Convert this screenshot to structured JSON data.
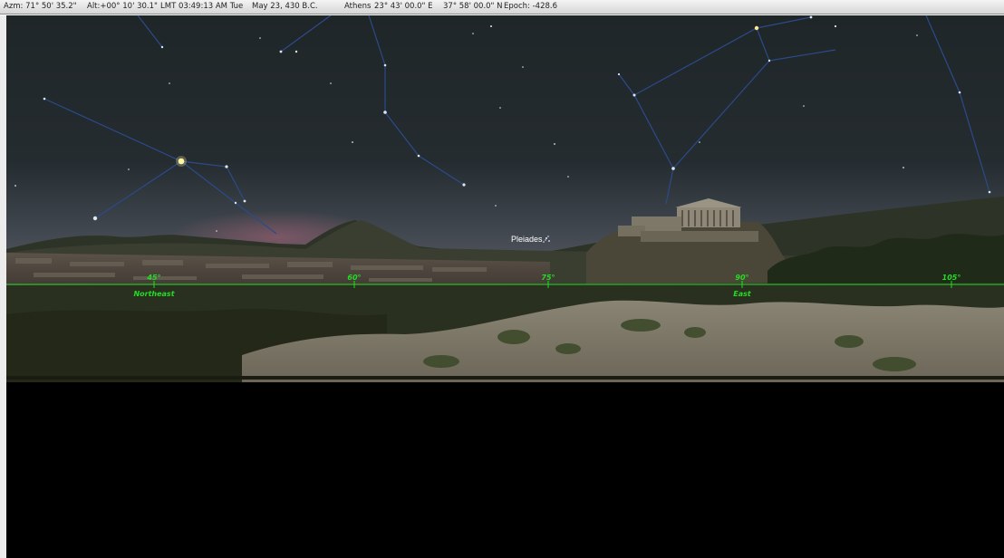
{
  "statusbar": {
    "azm": "Azm: 71° 50' 35.2\"",
    "alt": "Alt:+00° 10' 30.1\"",
    "lmt": "LMT 03:49:13 AM  Tue",
    "date": "May 23, 430 B.C.",
    "location": "Athens",
    "longitude": "23° 43' 00.0\" E",
    "latitude": "37° 58' 00.0\" N",
    "epoch": "Epoch: -428.6"
  },
  "sky": {
    "object_label": "Pleiades"
  },
  "horizon": {
    "color": "#22dd22",
    "ticks": [
      {
        "degree": "45°",
        "direction": "Northeast"
      },
      {
        "degree": "60°",
        "direction": ""
      },
      {
        "degree": "75°",
        "direction": ""
      },
      {
        "degree": "90°",
        "direction": "East"
      },
      {
        "degree": "105°",
        "direction": ""
      }
    ]
  }
}
